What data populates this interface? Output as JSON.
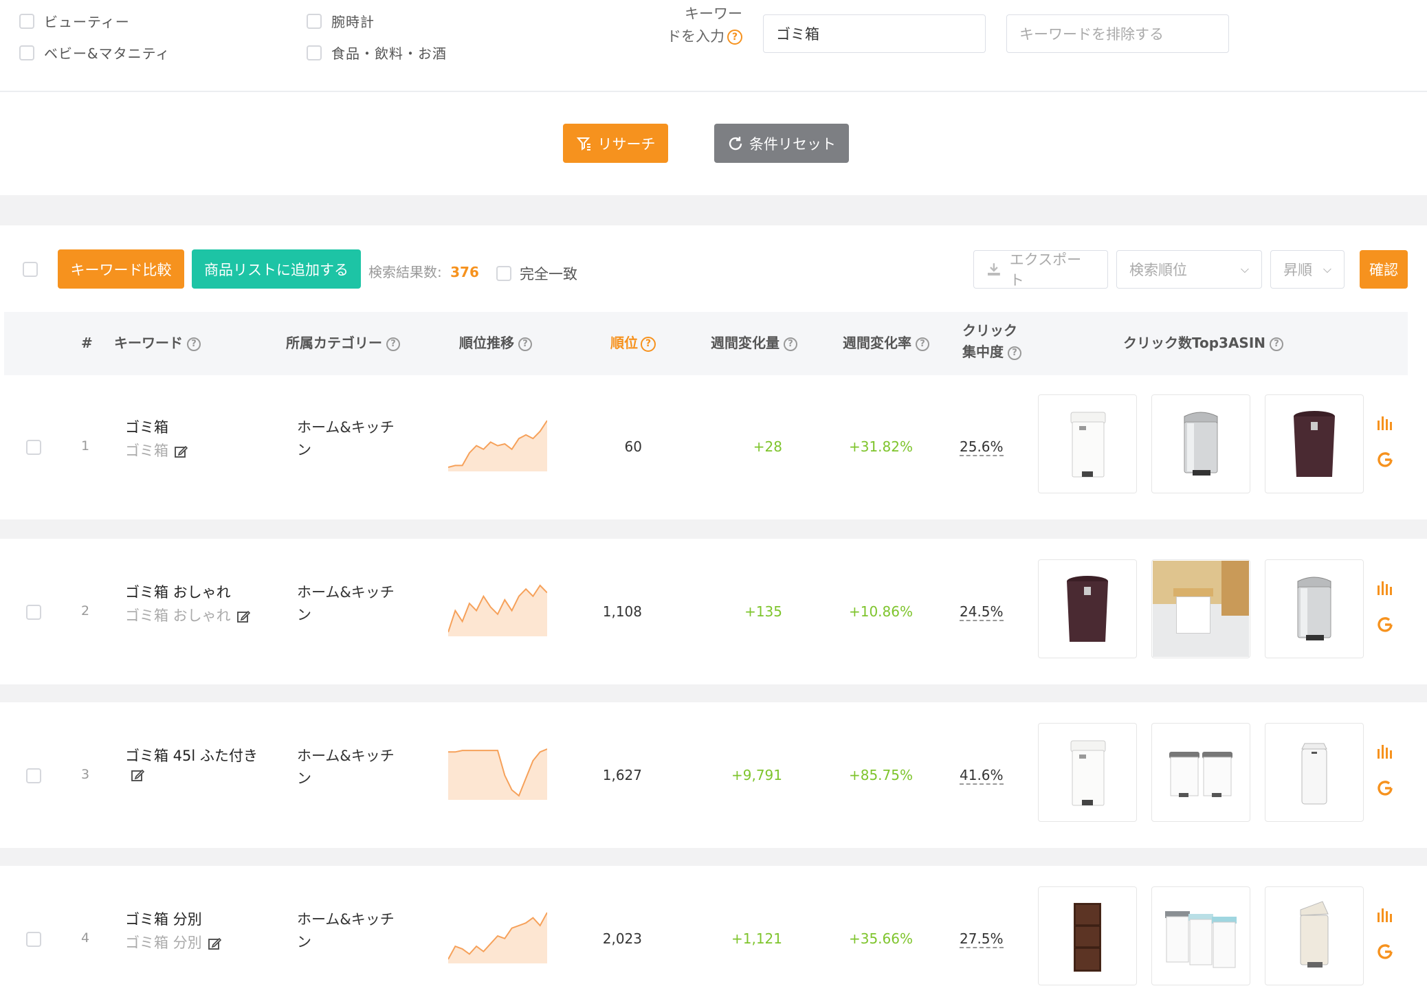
{
  "filters": {
    "categories": [
      {
        "label": "ビューティー"
      },
      {
        "label": "ベビー&マタニティ"
      },
      {
        "label": "腕時計"
      },
      {
        "label": "食品・飲料・お酒"
      }
    ],
    "keyword_label_line1": "キーワー",
    "keyword_label_line2": "ドを入力",
    "keyword_value": "ゴミ箱",
    "exclude_placeholder": "キーワードを排除する",
    "search_button": "リサーチ",
    "reset_button": "条件リセット"
  },
  "toolbar": {
    "compare_button": "キーワード比較",
    "add_list_button": "商品リストに追加する",
    "result_count_label": "検索結果数:",
    "result_count": "376",
    "exact_match_label": "完全一致",
    "export_button": "エクスポート",
    "sort_field": "検索順位",
    "sort_order": "昇順",
    "confirm_button": "確認"
  },
  "table": {
    "headers": {
      "index": "#",
      "keyword": "キーワード",
      "category": "所属カテゴリー",
      "trend": "順位推移",
      "rank": "順位",
      "weekly_change": "週間変化量",
      "weekly_rate": "週間変化率",
      "click_conc_line1": "クリック",
      "click_conc_line2": "集中度",
      "top3": "クリック数Top3ASIN"
    },
    "rows": [
      {
        "index": "1",
        "keyword": "ゴミ箱",
        "keyword_sub": "ゴミ箱",
        "category_line1": "ホーム&キッチ",
        "category_line2": "ン",
        "rank": "60",
        "weekly_change": "+28",
        "weekly_rate": "+31.82%",
        "click_concentration": "25.6%",
        "trend": [
          2,
          3,
          3,
          10,
          14,
          12,
          16,
          14,
          15,
          12,
          18,
          20,
          18,
          22,
          28
        ],
        "thumbs": [
          "white-pedal-bin",
          "steel-pedal-bin",
          "brown-round-bin"
        ]
      },
      {
        "index": "2",
        "keyword": "ゴミ箱 おしゃれ",
        "keyword_sub": "ゴミ箱 おしゃれ",
        "category_line1": "ホーム&キッチ",
        "category_line2": "ン",
        "rank": "1,108",
        "weekly_change": "+135",
        "weekly_rate": "+10.86%",
        "click_conc_placeholder": "",
        "click_concentration": "24.5%",
        "trend": [
          2,
          14,
          8,
          18,
          14,
          22,
          16,
          12,
          20,
          14,
          22,
          26,
          22,
          28,
          24
        ],
        "thumbs": [
          "brown-round-bin",
          "wood-lid-bin",
          "steel-pedal-bin"
        ]
      },
      {
        "index": "3",
        "keyword": "ゴミ箱 45l ふた付き",
        "keyword_sub": "",
        "category_line1": "ホーム&キッチ",
        "category_line2": "ン",
        "rank": "1,627",
        "weekly_change": "+9,791",
        "weekly_rate": "+85.75%",
        "click_concentration": "41.6%",
        "trend": [
          30,
          30,
          31,
          31,
          31,
          31,
          31,
          31,
          14,
          4,
          0,
          12,
          24,
          30,
          32
        ],
        "thumbs": [
          "white-pedal-bin",
          "twin-gray-lid-bins",
          "white-sensor-bin"
        ]
      },
      {
        "index": "4",
        "keyword": "ゴミ箱 分別",
        "keyword_sub": "ゴミ箱 分別",
        "category_line1": "ホーム&キッチ",
        "category_line2": "ン",
        "rank": "2,023",
        "weekly_change": "+1,121",
        "weekly_rate": "+35.66%",
        "click_concentration": "27.5%",
        "trend": [
          2,
          12,
          10,
          6,
          12,
          8,
          14,
          20,
          18,
          26,
          28,
          30,
          34,
          28,
          38
        ],
        "thumbs": [
          "brown-drawer-bin",
          "triple-sort-bins",
          "cream-pedal-bin"
        ]
      }
    ]
  },
  "colors": {
    "accent": "#f6921e",
    "teal": "#1dc4a5",
    "positive": "#7ec42c"
  }
}
